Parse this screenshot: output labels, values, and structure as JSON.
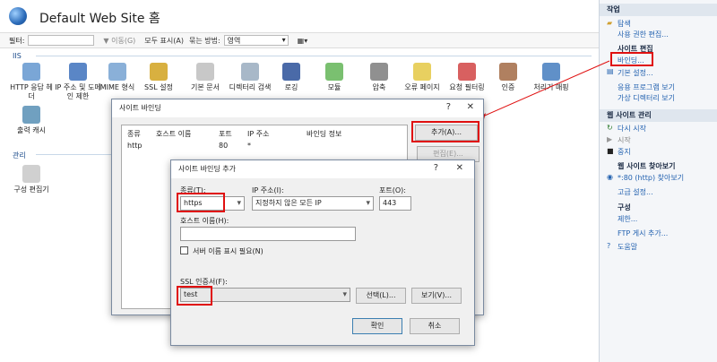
{
  "header": {
    "title": "Default Web Site 홈"
  },
  "filterbar": {
    "filter_label": "필터:",
    "go_label": "▼ 이동(G)",
    "show_all_label": "모두 표시(A)",
    "group_label": "묶는 방법:",
    "group_value": "영역"
  },
  "sections": {
    "iis": "IIS",
    "management": "관리"
  },
  "features": [
    "HTTP 응답 헤더",
    "IP 주소 및 도메인 제한",
    "MIME 형식",
    "SSL 설정",
    "기본 문서",
    "디렉터리 검색",
    "로깅",
    "모듈",
    "압축",
    "오류 페이지",
    "요청 필터링",
    "인증",
    "처리기 매핑",
    "출력 캐시",
    "구성 편집기"
  ],
  "actions": {
    "header": "작업",
    "explore": "탐색",
    "edit_perms": "사용 권한 편집...",
    "site_edit_header": "사이트 편집",
    "bindings": "바인딩...",
    "basic_settings": "기본 설정...",
    "view_apps": "응용 프로그램 보기",
    "view_vdirs": "가상 디렉터리 보기",
    "manage_header": "웹 사이트 관리",
    "restart": "다시 시작",
    "start": "시작",
    "stop": "중지",
    "browse_header": "웹 사이트 찾아보기",
    "browse_80": "*:80 (http) 찾아보기",
    "advanced": "고급 설정...",
    "config_header": "구성",
    "limits": "제한...",
    "ftp": "FTP 게시 추가...",
    "help": "도움말"
  },
  "bindings_dialog": {
    "title": "사이트 바인딩",
    "help": "?",
    "close": "✕",
    "columns": [
      "종류",
      "호스트 이름",
      "포트",
      "IP 주소",
      "바인딩 정보"
    ],
    "row": {
      "type": "http",
      "host": "",
      "port": "80",
      "ip": "*",
      "info": ""
    },
    "add_button": "추가(A)...",
    "edit_button": "편집(E)..."
  },
  "add_dialog": {
    "title": "사이트 바인딩 추가",
    "help": "?",
    "close": "✕",
    "type_label": "종류(T):",
    "type_value": "https",
    "ip_label": "IP 주소(I):",
    "ip_value": "지정하지 않은 모든 IP",
    "port_label": "포트(O):",
    "port_value": "443",
    "host_label": "호스트 이름(H):",
    "host_value": "",
    "sni_label": "서버 이름 표시 필요(N)",
    "ssl_label": "SSL 인증서(F):",
    "ssl_value": "test",
    "select_button": "선택(L)...",
    "view_button": "보기(V)...",
    "ok_button": "확인",
    "cancel_button": "취소"
  }
}
